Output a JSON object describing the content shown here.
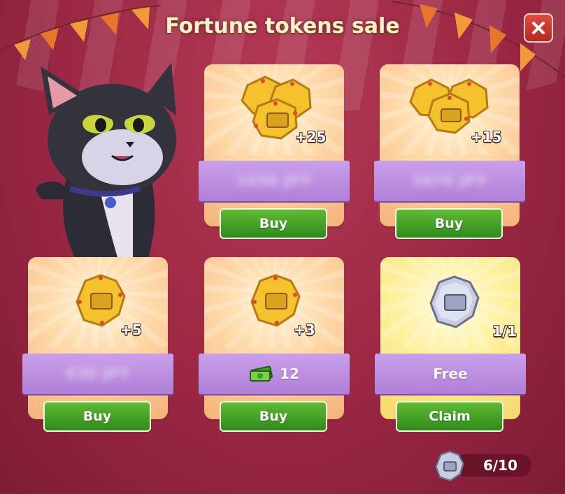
{
  "header": {
    "title": "Fortune tokens sale"
  },
  "offers": [
    {
      "amount": "+25",
      "price": "1650 JPY",
      "button": "Buy"
    },
    {
      "amount": "+15",
      "price": "1070 JPY",
      "button": "Buy"
    },
    {
      "amount": "+5",
      "price": "430 JPY",
      "button": "Buy"
    },
    {
      "amount": "+3",
      "price": "12",
      "button": "Buy",
      "currency_icon": "cash-icon"
    },
    {
      "amount": "1/1",
      "price": "Free",
      "button": "Claim",
      "token": "silver-token"
    }
  ],
  "counter": {
    "value": "6/10",
    "icon": "silver-token-icon"
  },
  "colors": {
    "buy_button": "#3c9a24",
    "ribbon": "#b889e0",
    "background": "#9a2743"
  }
}
